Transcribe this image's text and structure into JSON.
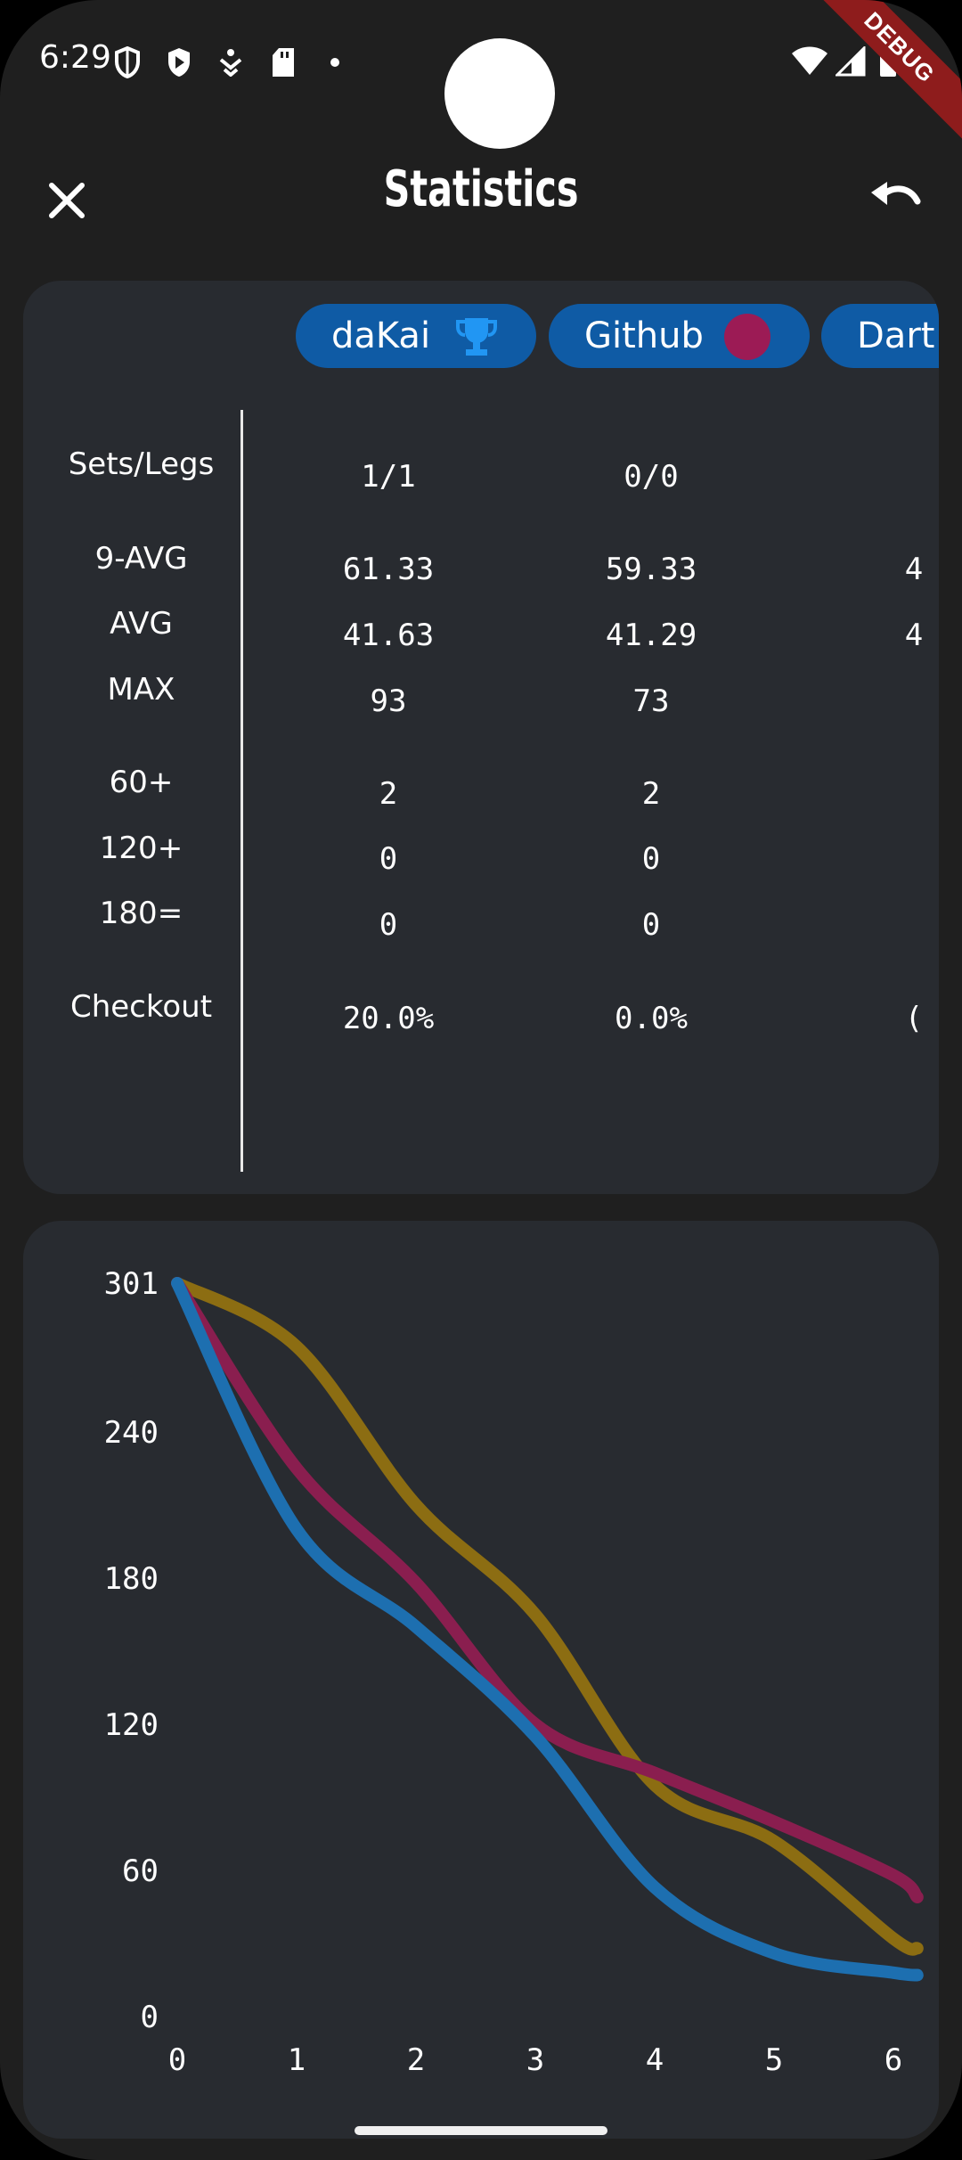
{
  "status_bar": {
    "time": "6:29",
    "debug_label": "DEBUG"
  },
  "app_bar": {
    "title": "Statistics",
    "close_icon": "close-icon",
    "undo_icon": "undo-icon"
  },
  "players": [
    {
      "name": "daKai",
      "badge": "trophy-icon",
      "badge_color": "#2196f3"
    },
    {
      "name": "Github",
      "badge": "dot-icon",
      "badge_color": "#9c1b55"
    },
    {
      "name": "Dart",
      "badge": "",
      "badge_color": ""
    }
  ],
  "stat_labels": [
    "Sets/Legs",
    "9-AVG",
    "AVG",
    "MAX",
    "60+",
    "120+",
    "180=",
    "Checkout"
  ],
  "stats": [
    {
      "sets_legs": "1/1",
      "avg9": "61.33",
      "avg": "41.63",
      "max": "93",
      "s60": "2",
      "s120": "0",
      "s180": "0",
      "checkout": "20.0%"
    },
    {
      "sets_legs": "0/0",
      "avg9": "59.33",
      "avg": "41.29",
      "max": "73",
      "s60": "2",
      "s120": "0",
      "s180": "0",
      "checkout": "0.0%"
    },
    {
      "sets_legs": "",
      "avg9": "4",
      "avg": "4",
      "max": "",
      "s60": "",
      "s120": "",
      "s180": "",
      "checkout": "("
    }
  ],
  "colors": {
    "background": "#1f1f1f",
    "card": "#282b30",
    "chip": "#0f5ba5",
    "series_blue": "#1d6fb0",
    "series_magenta": "#8a1e4f",
    "series_gold": "#8c6d12"
  },
  "chart_data": {
    "type": "line",
    "x_ticks": [
      "0",
      "1",
      "2",
      "3",
      "4",
      "5",
      "6"
    ],
    "y_ticks": [
      "0",
      "60",
      "120",
      "180",
      "240",
      "301"
    ],
    "xlim": [
      0,
      6.2
    ],
    "ylim": [
      0,
      301
    ],
    "grid": false,
    "series": [
      {
        "color": "#8c6d12",
        "values": [
          [
            0,
            301
          ],
          [
            1,
            275
          ],
          [
            2,
            210
          ],
          [
            3,
            165
          ],
          [
            4,
            95
          ],
          [
            5,
            72
          ],
          [
            6,
            32
          ],
          [
            6.2,
            28
          ]
        ]
      },
      {
        "color": "#8a1e4f",
        "values": [
          [
            0,
            301
          ],
          [
            1,
            225
          ],
          [
            2,
            178
          ],
          [
            3,
            120
          ],
          [
            4,
            100
          ],
          [
            5,
            80
          ],
          [
            6,
            58
          ],
          [
            6.2,
            49
          ]
        ]
      },
      {
        "color": "#1d6fb0",
        "values": [
          [
            0,
            301
          ],
          [
            1,
            200
          ],
          [
            2,
            160
          ],
          [
            3,
            115
          ],
          [
            4,
            53
          ],
          [
            5,
            26
          ],
          [
            6,
            18
          ],
          [
            6.2,
            17
          ]
        ]
      }
    ]
  }
}
